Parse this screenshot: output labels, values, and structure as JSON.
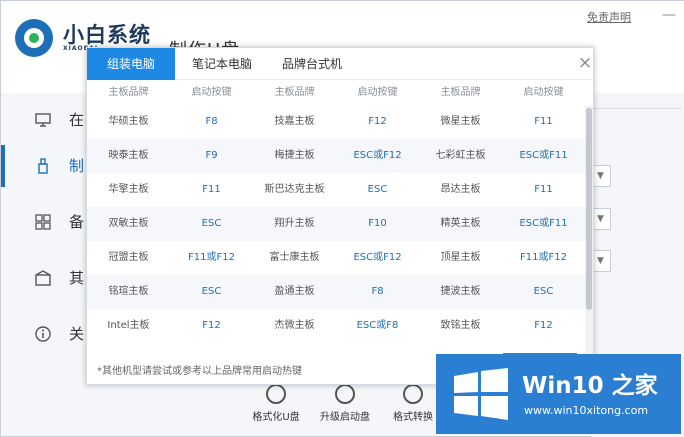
{
  "app": {
    "brand": "小白系统",
    "brand_sub": "XIAOBAI",
    "page_heading": "制作U盘",
    "disclaimer": "免责声明",
    "minimize": "—",
    "colors": {
      "accent": "#1e6fb7",
      "tab_active": "#1e88e5",
      "watermark": "#2a7fd3"
    }
  },
  "sidebar": {
    "items": [
      {
        "label": "在",
        "icon": "monitor-icon"
      },
      {
        "label": "制",
        "icon": "usb-icon"
      },
      {
        "label": "备",
        "icon": "grid-icon"
      },
      {
        "label": "其",
        "icon": "box-icon"
      },
      {
        "label": "关",
        "icon": "info-icon"
      }
    ]
  },
  "bottom_tools": [
    {
      "label": "格式化U盘",
      "icon": "format-icon"
    },
    {
      "label": "升级启动盘",
      "icon": "upgrade-icon"
    },
    {
      "label": "格式转换",
      "icon": "convert-icon"
    }
  ],
  "modal": {
    "tabs": [
      "组装电脑",
      "笔记本电脑",
      "品牌台式机"
    ],
    "active_tab": 0,
    "close": "×",
    "headers": [
      "主板品牌",
      "启动按键",
      "主板品牌",
      "启动按键",
      "主板品牌",
      "启动按键"
    ],
    "rows": [
      [
        "华硕主板",
        "F8",
        "技嘉主板",
        "F12",
        "微星主板",
        "F11"
      ],
      [
        "映泰主板",
        "F9",
        "梅捷主板",
        "ESC或F12",
        "七彩虹主板",
        "ESC或F11"
      ],
      [
        "华擎主板",
        "F11",
        "斯巴达克主板",
        "ESC",
        "昂达主板",
        "F11"
      ],
      [
        "双敏主板",
        "ESC",
        "翔升主板",
        "F10",
        "精英主板",
        "ESC或F11"
      ],
      [
        "冠盟主板",
        "F11或F12",
        "富士康主板",
        "ESC或F12",
        "顶星主板",
        "F11或F12"
      ],
      [
        "铭瑄主板",
        "ESC",
        "盈通主板",
        "F8",
        "捷波主板",
        "ESC"
      ],
      [
        "Intel主板",
        "F12",
        "杰微主板",
        "ESC或F8",
        "致铭主板",
        "F12"
      ]
    ],
    "footnote": "*其他机型请尝试或参考以上品牌常用启动热键"
  },
  "watermark": {
    "title": "Win10 之家",
    "url": "www.win10xitong.com"
  }
}
